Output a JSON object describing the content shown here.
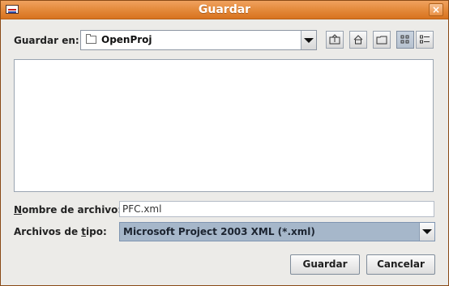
{
  "window": {
    "title": "Guardar"
  },
  "labels": {
    "save_in": "Guardar en:",
    "file_name_prefix": "",
    "file_name_u": "N",
    "file_name_rest": "ombre de archivo:",
    "file_type_prefix": "Archivos de ",
    "file_type_u": "t",
    "file_type_rest": "ipo:"
  },
  "save_in_combo": {
    "selected": "OpenProj"
  },
  "toolbar": {
    "icons": [
      "up-one-level-icon",
      "home-icon",
      "new-folder-icon",
      "list-view-icon",
      "details-view-icon"
    ]
  },
  "file_name": {
    "value": "PFC.xml"
  },
  "file_type": {
    "selected": "Microsoft Project 2003 XML (*.xml)"
  },
  "buttons": {
    "save": "Guardar",
    "cancel": "Cancelar"
  },
  "colors": {
    "titlebar": "#e58c3e",
    "selection": "#a6b7ca"
  }
}
